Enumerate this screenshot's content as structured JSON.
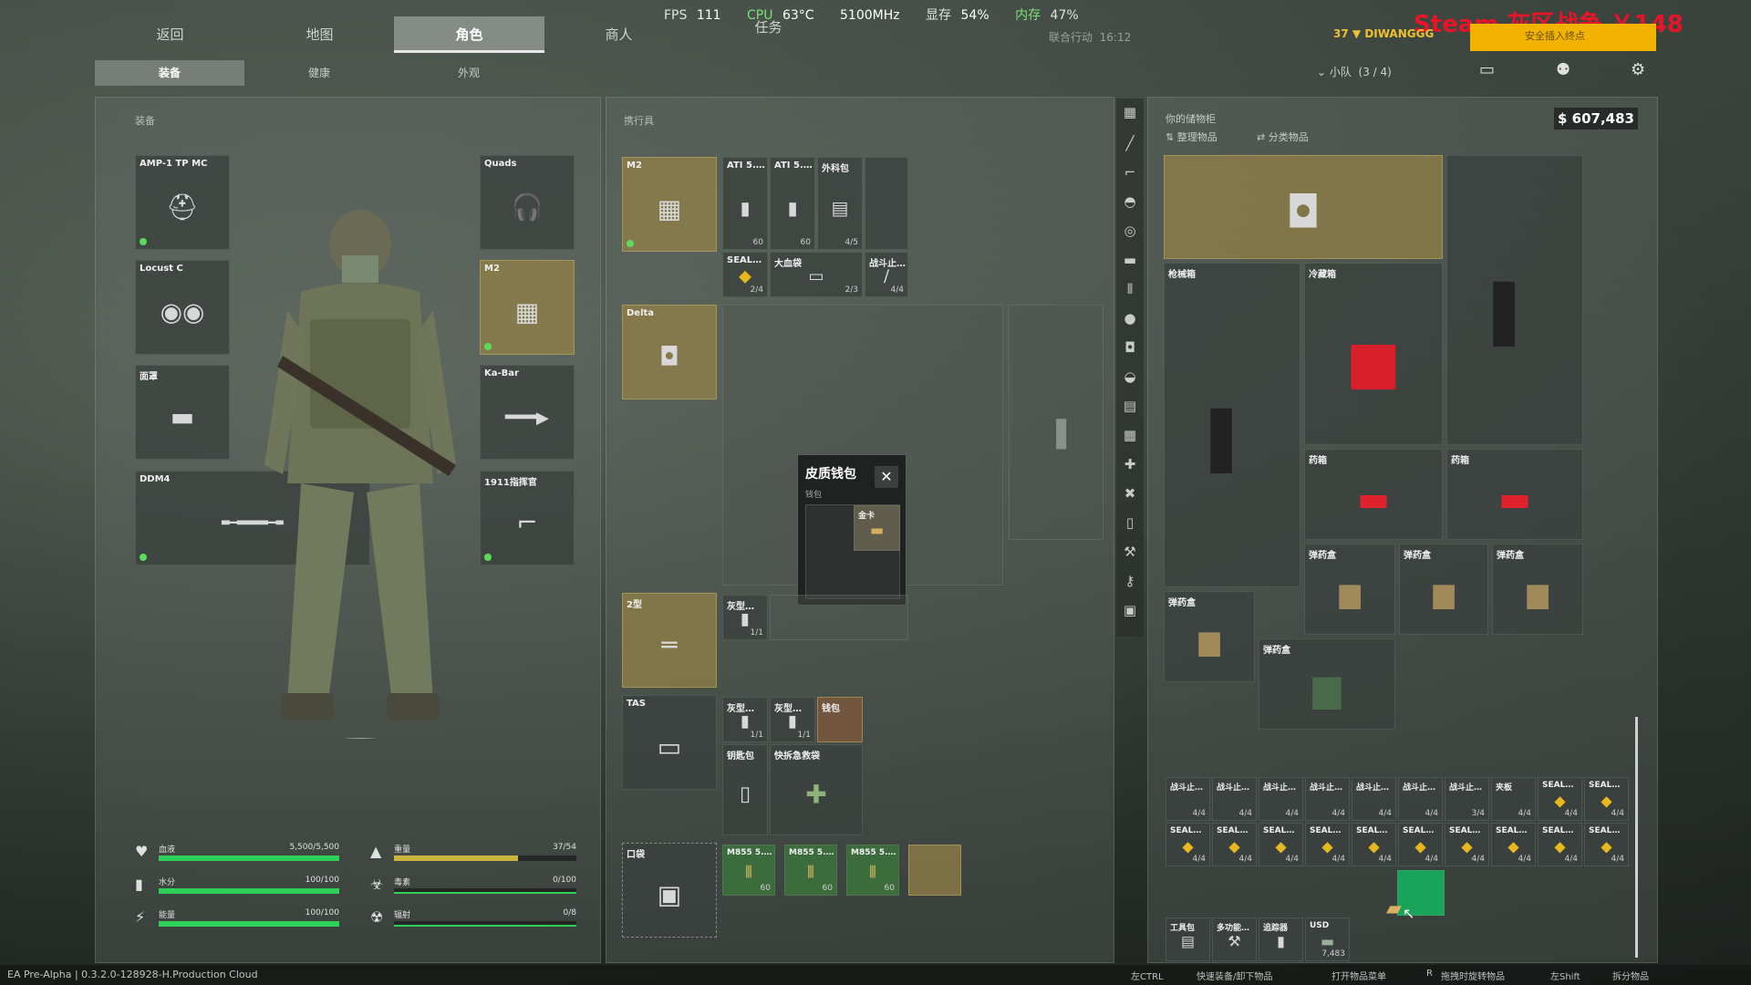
{
  "perf": {
    "fps_label": "FPS",
    "fps": "111",
    "cpu_label": "CPU",
    "cpu_temp": "63°C",
    "freq": "5100MHz",
    "vram_label": "显存",
    "vram": "54%",
    "ram_label": "内存",
    "ram": "47%"
  },
  "nav": {
    "tabs": [
      "返回",
      "地图",
      "角色",
      "商人",
      "任务"
    ],
    "active": "角色",
    "subtabs": [
      "装备",
      "健康",
      "外观"
    ],
    "mission": "联合行动",
    "time": "16:12"
  },
  "overlay": {
    "steam": "Steam  灰区战争  ￥148"
  },
  "player": {
    "level": "37",
    "name": "DIWANGGG",
    "squad_label": "小队",
    "squad_count": "(3 / 4)",
    "btn": "安全插入终点"
  },
  "equipment": {
    "title": "装备",
    "slots": [
      {
        "label": "AMP-1 TP MC"
      },
      {
        "label": "Locust C"
      },
      {
        "label": "面罩"
      },
      {
        "label": "DDM4"
      },
      {
        "label": "Quads"
      },
      {
        "label": "M2"
      },
      {
        "label": "Ka-Bar"
      },
      {
        "label": "1911指挥官"
      }
    ]
  },
  "carried": {
    "title": "携行具",
    "rig": "M2",
    "rig_items": [
      {
        "label": "ATI 5.…",
        "count": "60"
      },
      {
        "label": "ATI 5.…",
        "count": "60"
      },
      {
        "label": "外科包",
        "count": "4/5"
      },
      {
        "label": "SEAL…",
        "count": "2/4"
      },
      {
        "label": "大血袋",
        "count": "2/3"
      },
      {
        "label": "战斗止…",
        "count": "4/4"
      }
    ],
    "backpack": "Delta",
    "belt": "2型",
    "belt_items": [
      {
        "label": "灰型…",
        "count": "1/1"
      }
    ],
    "case": "TAS",
    "case_items": [
      {
        "label": "灰型…",
        "count": "1/1"
      },
      {
        "label": "灰型…",
        "count": "1/1"
      },
      {
        "label": "钱包",
        "count": ""
      },
      {
        "label": "钥匙包",
        "count": ""
      },
      {
        "label": "快拆急救袋",
        "count": ""
      }
    ],
    "pocket": "口袋",
    "pocket_items": [
      {
        "label": "M855 5.…",
        "count": "60"
      },
      {
        "label": "M855 5.…",
        "count": "60"
      },
      {
        "label": "M855 5.…",
        "count": "60"
      }
    ]
  },
  "wallet_popup": {
    "title": "皮质钱包",
    "sub": "钱包",
    "item": "金卡"
  },
  "stats": [
    {
      "name": "血液",
      "value": "5,500/5,500",
      "fill": 1.0,
      "icon": "♥"
    },
    {
      "name": "水分",
      "value": "100/100",
      "fill": 1.0,
      "icon": "▮"
    },
    {
      "name": "能量",
      "value": "100/100",
      "fill": 1.0,
      "icon": "⚡"
    },
    {
      "name": "重量",
      "value": "37/54",
      "fill": 0.68,
      "icon": "▲"
    },
    {
      "name": "毒素",
      "value": "0/100",
      "fill": 0.0,
      "icon": "☣"
    },
    {
      "name": "辐射",
      "value": "0/8",
      "fill": 0.0,
      "icon": "☢"
    }
  ],
  "stash": {
    "title": "你的储物柜",
    "sort": "整理物品",
    "cat": "分类物品",
    "money": "$ 607,483",
    "big": [
      {
        "label": "枪械箱"
      },
      {
        "label": "冷藏箱"
      },
      {
        "label": "药箱"
      },
      {
        "label": "药箱"
      },
      {
        "label": "弹药盒"
      },
      {
        "label": "弹药盒"
      },
      {
        "label": "弹药盒"
      },
      {
        "label": "弹药盒"
      },
      {
        "label": "弹药盒"
      }
    ],
    "row1": [
      {
        "label": "战斗止…",
        "count": "4/4"
      },
      {
        "label": "战斗止…",
        "count": "4/4"
      },
      {
        "label": "战斗止…",
        "count": "4/4"
      },
      {
        "label": "战斗止…",
        "count": "4/4"
      },
      {
        "label": "战斗止…",
        "count": "4/4"
      },
      {
        "label": "战斗止…",
        "count": "4/4"
      },
      {
        "label": "战斗止…",
        "count": "3/4"
      },
      {
        "label": "夹板",
        "count": "4/4"
      },
      {
        "label": "SEAL…",
        "count": "4/4"
      },
      {
        "label": "SEAL…",
        "count": "4/4"
      }
    ],
    "row2": [
      {
        "label": "SEAL…",
        "count": "4/4"
      },
      {
        "label": "SEAL…",
        "count": "4/4"
      },
      {
        "label": "SEAL…",
        "count": "4/4"
      },
      {
        "label": "SEAL…",
        "count": "4/4"
      },
      {
        "label": "SEAL…",
        "count": "4/4"
      },
      {
        "label": "SEAL…",
        "count": "4/4"
      },
      {
        "label": "SEAL…",
        "count": "4/4"
      },
      {
        "label": "SEAL…",
        "count": "4/4"
      },
      {
        "label": "SEAL…",
        "count": "4/4"
      },
      {
        "label": "SEAL…",
        "count": "4/4"
      }
    ],
    "row3": [
      {
        "label": "工具包",
        "count": ""
      },
      {
        "label": "多功能…",
        "count": ""
      },
      {
        "label": "追踪器",
        "count": ""
      },
      {
        "label": "USD",
        "count": "7,483"
      }
    ]
  },
  "footer": {
    "version": "EA Pre-Alpha | 0.3.2.0-128928-H.Production Cloud",
    "h1": "左CTRL",
    "h2": "快速装备/卸下物品",
    "h3": "打开物品菜单",
    "h4": "R",
    "h5": "拖拽时旋转物品",
    "h6": "左Shift",
    "h7": "拆分物品"
  }
}
